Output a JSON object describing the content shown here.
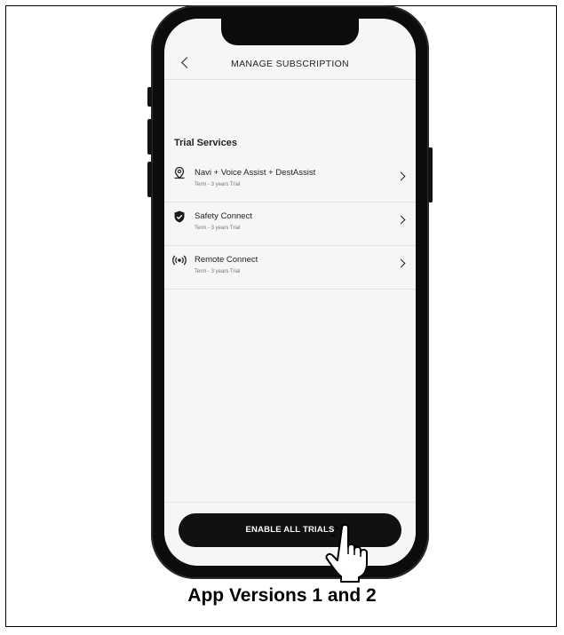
{
  "header": {
    "title": "MANAGE SUBSCRIPTION"
  },
  "section": {
    "title": "Trial Services"
  },
  "services": [
    {
      "name": "Navi + Voice Assist + DestAssist",
      "term": "Term - 3 years Trial",
      "icon": "location-pin-icon"
    },
    {
      "name": "Safety Connect",
      "term": "Term - 3 years Trial",
      "icon": "shield-check-icon"
    },
    {
      "name": "Remote Connect",
      "term": "Term - 3 years Trial",
      "icon": "broadcast-icon"
    }
  ],
  "actions": {
    "enable_label": "ENABLE ALL TRIALS"
  },
  "caption": "App Versions 1 and 2"
}
